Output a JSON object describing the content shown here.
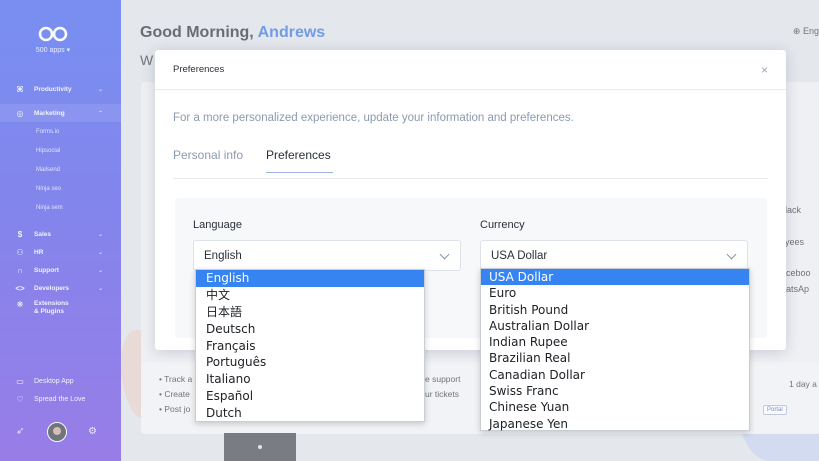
{
  "sidebar": {
    "apps_label": "500 apps",
    "nav": [
      {
        "label": "Productivity",
        "icon": "command-icon"
      },
      {
        "label": "Marketing",
        "icon": "target-icon",
        "expanded": true,
        "children": [
          "Forms.io",
          "Hipsocial",
          "Mailsend",
          "Ninja seo",
          "Ninja sem"
        ]
      },
      {
        "label": "Sales",
        "icon": "dollar-icon"
      },
      {
        "label": "HR",
        "icon": "people-icon"
      },
      {
        "label": "Support",
        "icon": "headset-icon"
      },
      {
        "label": "Developers",
        "icon": "code-icon"
      },
      {
        "label": "Extensions & Plugins",
        "icon": "puzzle-icon"
      }
    ],
    "extensions_line1": "Extensions",
    "extensions_line2": "& Plugins",
    "bottom": [
      {
        "label": "Desktop App",
        "icon": "monitor-icon"
      },
      {
        "label": "Spread the Love",
        "icon": "heart-icon"
      }
    ]
  },
  "header": {
    "greeting_prefix": "Good Morning,",
    "user_name": "Andrews",
    "welcome_partial": "W",
    "language_partial": "Eng"
  },
  "background": {
    "right_snippets": [
      "lack",
      "yees",
      "aceboo",
      "hatsAp"
    ],
    "left_list": [
      "• Track a",
      "• Create",
      "• Post jo"
    ],
    "mid_snippets": [
      "e support",
      "ur tickets"
    ],
    "time_ago": "1 day a",
    "tags": [
      "Portal"
    ]
  },
  "modal": {
    "title": "Preferences",
    "close_glyph": "×",
    "description": "For a more personalized experience, update your information and preferences.",
    "tabs": [
      {
        "label": "Personal info",
        "active": false
      },
      {
        "label": "Preferences",
        "active": true
      }
    ],
    "language": {
      "label": "Language",
      "value": "English",
      "options": [
        "English",
        "中文",
        "日本語",
        "Deutsch",
        "Français",
        "Português",
        "Italiano",
        "Español",
        "Dutch"
      ],
      "selected_index": 0
    },
    "currency": {
      "label": "Currency",
      "value": "USA Dollar",
      "options": [
        "USA Dollar",
        "Euro",
        "British Pound",
        "Australian Dollar",
        "Indian Rupee",
        "Brazilian Real",
        "Canadian Dollar",
        "Swiss Franc",
        "Chinese Yuan",
        "Japanese Yen"
      ],
      "selected_index": 0
    }
  },
  "colors": {
    "sidebar_top": "#3a5bf0",
    "sidebar_bottom": "#6b3fe0",
    "accent_name": "#2f6fde",
    "option_highlight": "#3584f2"
  }
}
